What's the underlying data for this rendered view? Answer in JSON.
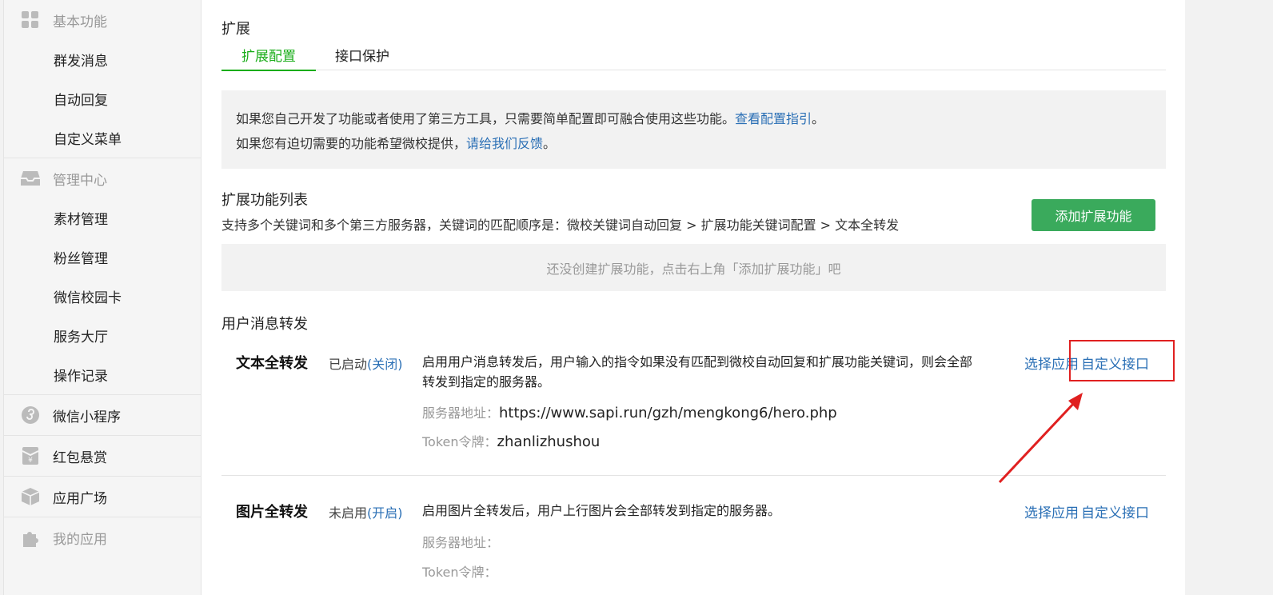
{
  "sidebar": {
    "basic": {
      "label": "基本功能",
      "items": [
        "群发消息",
        "自动回复",
        "自定义菜单"
      ]
    },
    "manage": {
      "label": "管理中心",
      "items": [
        "素材管理",
        "粉丝管理",
        "微信校园卡",
        "服务大厅",
        "操作记录"
      ]
    },
    "mini": "微信小程序",
    "redpack": "红包悬赏",
    "plaza": "应用广场",
    "myapps": "我的应用"
  },
  "page": {
    "section_title": "扩展",
    "tabs": [
      "扩展配置",
      "接口保护"
    ],
    "notice": {
      "line1": "如果您自己开发了功能或者使用了第三方工具，只需要简单配置即可融合使用这些功能。",
      "line1_link": "查看配置指引",
      "line1_end": "。",
      "line2": "如果您有迫切需要的功能希望微校提供，",
      "line2_link": "请给我们反馈",
      "line2_end": "。"
    },
    "list_title": "扩展功能列表",
    "list_desc": "支持多个关键词和多个第三方服务器，关键词的匹配顺序是：微校关键词自动回复 > 扩展功能关键词配置 > 文本全转发",
    "add_button": "添加扩展功能",
    "empty_text": "还没创建扩展功能，点击右上角「添加扩展功能」吧",
    "forward_title": "用户消息转发"
  },
  "rows": [
    {
      "name": "文本全转发",
      "status": "已启动",
      "toggle": "(关闭)",
      "desc": "启用用户消息转发后，用户输入的指令如果没有匹配到微校自动回复和扩展功能关键词，则会全部转发到指定的服务器。",
      "server_label": "服务器地址：",
      "server_value": "https://www.sapi.run/gzh/mengkong6/hero.php",
      "token_label": "Token令牌：",
      "token_value": "zhanlizhushou",
      "action1": "选择应用",
      "action2": "自定义接口"
    },
    {
      "name": "图片全转发",
      "status": "未启用",
      "toggle": "(开启)",
      "desc": "启用图片全转发后，用户上行图片会全部转发到指定的服务器。",
      "server_label": "服务器地址：",
      "server_value": "",
      "token_label": "Token令牌：",
      "token_value": "",
      "action1": "选择应用",
      "action2": "自定义接口"
    }
  ],
  "colors": {
    "green": "#1aad19",
    "button_green": "#3aaa5c",
    "link": "#2a6fb5",
    "annotation_red": "#e02020"
  }
}
